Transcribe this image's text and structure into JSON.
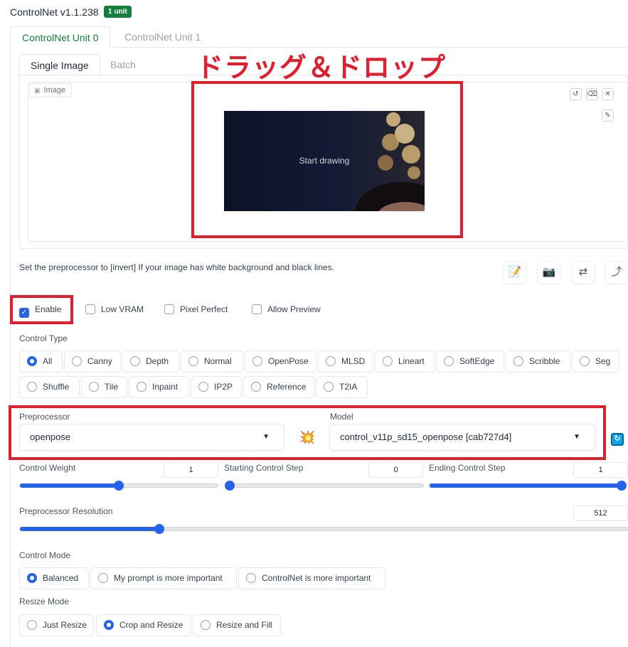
{
  "header": {
    "title": "ControlNet v1.1.238",
    "badge": "1 unit"
  },
  "unit_tabs": [
    {
      "label": "ControlNet Unit 0",
      "active": true
    },
    {
      "label": "ControlNet Unit 1",
      "active": false
    }
  ],
  "image_tabs": [
    {
      "label": "Single Image",
      "active": true
    },
    {
      "label": "Batch",
      "active": false
    }
  ],
  "image_panel": {
    "label": "Image",
    "canvas_text": "Start drawing",
    "tools": {
      "undo": "↺",
      "erase": "⌫",
      "clear": "✕",
      "brush": "✎"
    }
  },
  "annotation": {
    "drag_drop": "ドラッグ＆ドロップ",
    "color": "#e11d2e"
  },
  "hint": "Set the preprocessor to [invert] If your image has white background and black lines.",
  "action_buttons": [
    "📝",
    "📷",
    "⇄",
    "⤴"
  ],
  "options": [
    {
      "label": "Enable",
      "checked": true
    },
    {
      "label": "Low VRAM",
      "checked": false
    },
    {
      "label": "Pixel Perfect",
      "checked": false
    },
    {
      "label": "Allow Preview",
      "checked": false
    }
  ],
  "control_type": {
    "label": "Control Type",
    "items": [
      "All",
      "Canny",
      "Depth",
      "Normal",
      "OpenPose",
      "MLSD",
      "Lineart",
      "SoftEdge",
      "Scribble",
      "Seg",
      "Shuffle",
      "Tile",
      "Inpaint",
      "IP2P",
      "Reference",
      "T2IA"
    ],
    "selected": "All"
  },
  "preprocessor": {
    "label": "Preprocessor",
    "value": "openpose"
  },
  "model": {
    "label": "Model",
    "value": "control_v11p_sd15_openpose [cab727d4]"
  },
  "run_icon": "💥",
  "refresh_icon": "↻",
  "sliders": {
    "control_weight": {
      "label": "Control Weight",
      "value": "1",
      "fraction": 0.5
    },
    "starting_step": {
      "label": "Starting Control Step",
      "value": "0",
      "fraction": 0
    },
    "ending_step": {
      "label": "Ending Control Step",
      "value": "1",
      "fraction": 1
    },
    "resolution": {
      "label": "Preprocessor Resolution",
      "value": "512",
      "fraction": 0.23
    }
  },
  "control_mode": {
    "label": "Control Mode",
    "items": [
      "Balanced",
      "My prompt is more important",
      "ControlNet is more important"
    ],
    "selected": "Balanced"
  },
  "resize_mode": {
    "label": "Resize Mode",
    "items": [
      "Just Resize",
      "Crop and Resize",
      "Resize and Fill"
    ],
    "selected": "Crop and Resize"
  },
  "colors": {
    "accent": "#2563eb",
    "green": "#15803d",
    "red": "#e11d2e"
  }
}
